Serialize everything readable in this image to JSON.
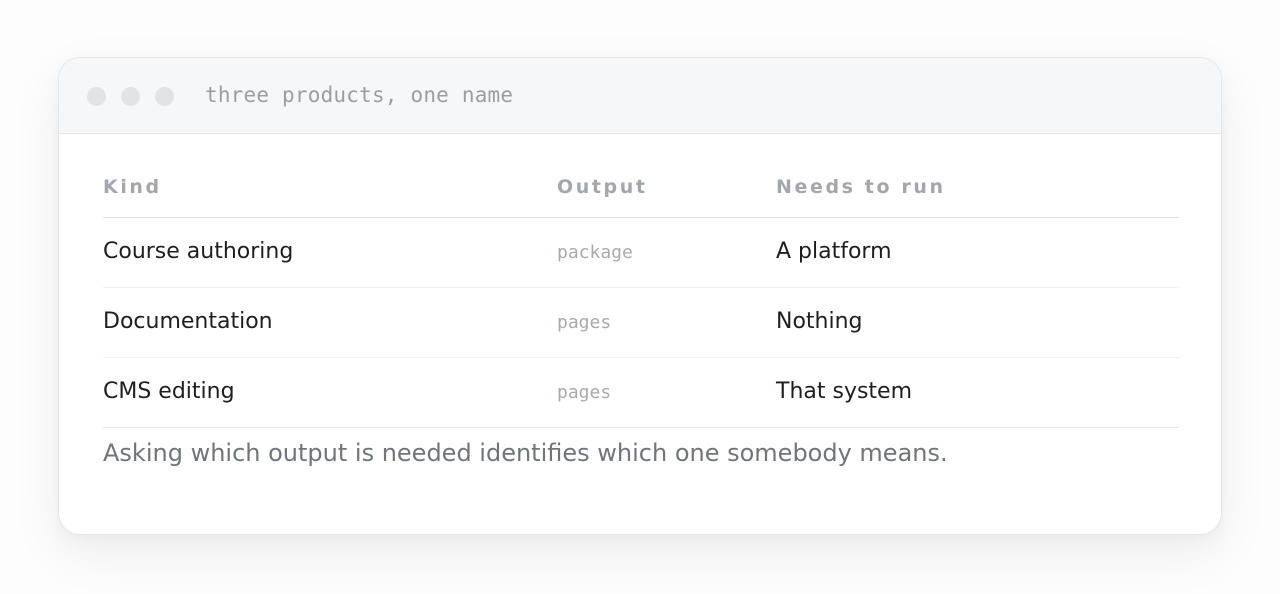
{
  "window": {
    "title": "three products, one name"
  },
  "table": {
    "headers": [
      "Kind",
      "Output",
      "Needs to run"
    ],
    "rows": [
      {
        "kind": "Course authoring",
        "output": "package",
        "needs": "A platform"
      },
      {
        "kind": "Documentation",
        "output": "pages",
        "needs": "Nothing"
      },
      {
        "kind": "CMS editing",
        "output": "pages",
        "needs": "That system"
      }
    ]
  },
  "footnote": "Asking which output is needed identifies which one somebody means.",
  "colors": {
    "titlebar_bg": "#f6f7f8",
    "header_text": "#a3a7ad",
    "body_text": "#1c1e21",
    "muted_text": "#70757c"
  }
}
